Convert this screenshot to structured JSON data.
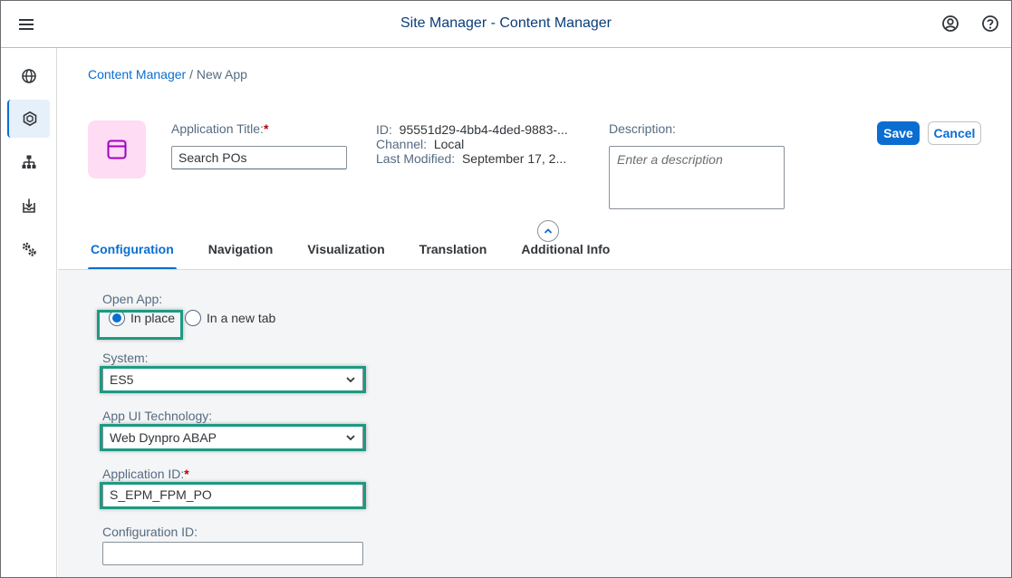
{
  "shell": {
    "title": "Site Manager - Content Manager",
    "menu_icon": "hamburger-menu-icon",
    "user_icon": "user-account-icon",
    "help_icon": "help-icon"
  },
  "sidenav": {
    "items": [
      {
        "name": "globe-icon",
        "active": false
      },
      {
        "name": "content-manager-icon",
        "active": true
      },
      {
        "name": "hierarchy-icon",
        "active": false
      },
      {
        "name": "inbox-download-icon",
        "active": false
      },
      {
        "name": "settings-gears-icon",
        "active": false
      }
    ]
  },
  "breadcrumb": {
    "link": "Content Manager",
    "separator": " / ",
    "current": "New App"
  },
  "header": {
    "app_icon": "app-window-icon",
    "title_label": "Application Title:",
    "required_mark": "*",
    "title_value": "Search POs",
    "id_label": "ID:",
    "id_value": "95551d29-4bb4-4ded-9883-...",
    "channel_label": "Channel:",
    "channel_value": "Local",
    "modified_label": "Last Modified:",
    "modified_value": "September 17, 2...",
    "description_label": "Description:",
    "description_placeholder": "Enter a description",
    "save_label": "Save",
    "cancel_label": "Cancel"
  },
  "tabs": [
    {
      "label": "Configuration",
      "active": true
    },
    {
      "label": "Navigation",
      "active": false
    },
    {
      "label": "Visualization",
      "active": false
    },
    {
      "label": "Translation",
      "active": false
    },
    {
      "label": "Additional Info",
      "active": false
    }
  ],
  "form": {
    "open_app_label": "Open App:",
    "open_app_options": [
      "In place",
      "In a new tab"
    ],
    "open_app_selected": "In place",
    "system_label": "System:",
    "system_value": "ES5",
    "tech_label": "App UI Technology:",
    "tech_value": "Web Dynpro ABAP",
    "app_id_label": "Application ID:",
    "app_id_value": "S_EPM_FPM_PO",
    "config_id_label": "Configuration ID:",
    "config_id_value": ""
  },
  "colors": {
    "accent": "#0a6ed1",
    "shell_title": "#0a3e7a",
    "highlight": "#1c9a83",
    "app_tile": "#fddcf4",
    "app_icon": "#a100c2",
    "required": "#bb0000"
  }
}
